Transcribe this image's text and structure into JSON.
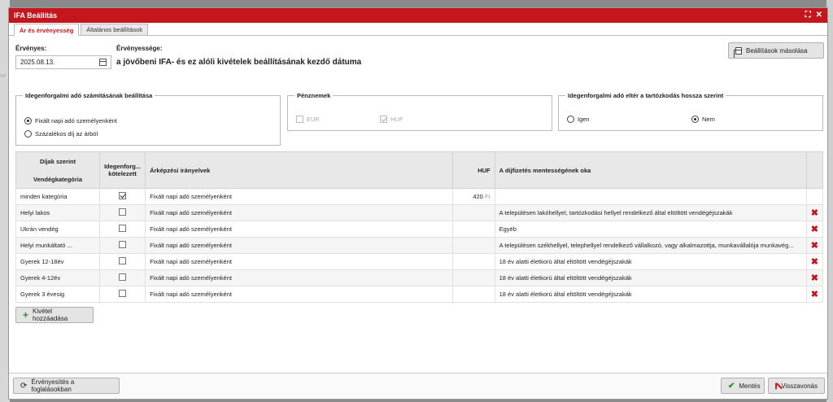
{
  "window": {
    "title": "IFA Beállítás",
    "maximize_glyph": "⛶",
    "close_glyph": "✕"
  },
  "bg_ghost": "ve",
  "tabs": [
    {
      "label": "Ár és érvényesség",
      "active": true
    },
    {
      "label": "Általános beállítások",
      "active": false
    }
  ],
  "validity": {
    "label": "Érvényes:",
    "date": "2025.08.13.",
    "scope_label": "Érvényessége:",
    "scope_text": "a jövőbeni IFA- és ez alóli kivételek beállításának kezdő dátuma"
  },
  "copy_button": {
    "label": "Beállítások másolása",
    "icon": "copy-icon"
  },
  "calc_group": {
    "legend": "Idegenforgalmi adó számításának beállítása",
    "options": [
      {
        "label": "Fixált napi adó személyenként",
        "selected": true
      },
      {
        "label": "Százalékos díj az árból",
        "selected": false
      }
    ]
  },
  "currency_group": {
    "legend": "Pénznemek",
    "options": [
      {
        "label": "EUR",
        "checked": false
      },
      {
        "label": "HUF",
        "checked": true
      }
    ]
  },
  "length_group": {
    "legend": "Idegenforgalmi adó eltér a tartózkodás hossza szerint",
    "options": [
      {
        "label": "Igen",
        "selected": false
      },
      {
        "label": "Nem",
        "selected": true
      }
    ]
  },
  "table": {
    "headers": {
      "col1_top": "Díjak szerint",
      "col1_bottom": "Vendégkategória",
      "col2": "Idegenforg... kötelezett",
      "col3": "Árképzési irányelvek",
      "col4": "HUF",
      "col5": "A díjfizetés mentességének oka"
    },
    "rows": [
      {
        "category": "minden kategória",
        "required": true,
        "pricing": "Fixált napi adó személyenként",
        "amount": "420",
        "unit": "Ft",
        "reason": "",
        "deletable": false
      },
      {
        "category": "Helyi lakos",
        "required": false,
        "pricing": "Fixált napi adó személyenként",
        "amount": "",
        "unit": "",
        "reason": "A településen lakóhellyel, tartózkodási hellyel rendelkező által eltöltött vendégéjszakák",
        "deletable": true
      },
      {
        "category": "Ukrán vendég",
        "required": false,
        "pricing": "Fixált napi adó személyenként",
        "amount": "",
        "unit": "",
        "reason": "Egyéb",
        "deletable": true
      },
      {
        "category": "Helyi munkáltató ...",
        "required": false,
        "pricing": "Fixált napi adó személyenként",
        "amount": "",
        "unit": "",
        "reason": "A településen székhellyel, telephellyel rendelkező vállalkozó, vagy alkalmazottja, munkavállalója munkavég...",
        "deletable": true
      },
      {
        "category": "Gyerek 12-18év",
        "required": false,
        "pricing": "Fixált napi adó személyenként",
        "amount": "",
        "unit": "",
        "reason": "18 év alatti életkorú által eltöltött vendégéjszakák",
        "deletable": true
      },
      {
        "category": "Gyerek 4-12év",
        "required": false,
        "pricing": "Fixált napi adó személyenként",
        "amount": "",
        "unit": "",
        "reason": "18 év alatti életkorú által eltöltött vendégéjszakák",
        "deletable": true
      },
      {
        "category": "Gyerek 3 évesig",
        "required": false,
        "pricing": "Fixált napi adó személyenként",
        "amount": "",
        "unit": "",
        "reason": "18 év alatti életkorú által eltöltött vendégéjszakák",
        "deletable": true
      }
    ],
    "delete_glyph": "✖"
  },
  "add_button": {
    "label": "Kivétel hozzáadása",
    "icon_glyph": "+"
  },
  "footer": {
    "validate_label": "Érvényesítés a foglalásokban",
    "validate_glyph": "⟳",
    "save_label": "Mentés",
    "save_glyph": "✔",
    "cancel_label": "Visszavonás"
  },
  "colors": {
    "accent": "#c4161c",
    "success": "#2c8a2c"
  }
}
